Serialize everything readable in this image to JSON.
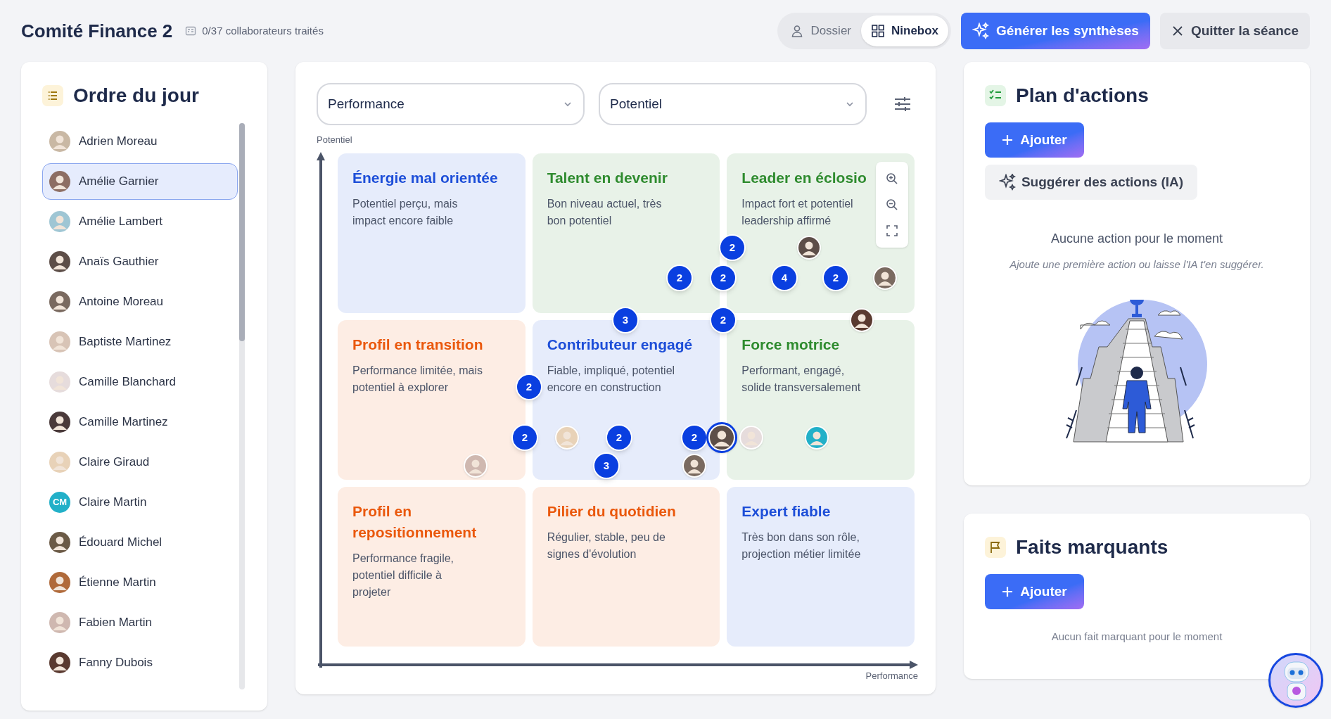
{
  "header": {
    "title": "Comité Finance 2",
    "progress": "0/37 collaborateurs traités"
  },
  "view_toggle": [
    {
      "label": "Dossier",
      "selected": false,
      "kind": "person"
    },
    {
      "label": "Ninebox",
      "selected": true,
      "kind": "grid"
    }
  ],
  "actions": [
    {
      "label": "Générer les synthèses",
      "kind": "primary"
    },
    {
      "label": "Quitter la séance",
      "kind": "secondary"
    }
  ],
  "agenda": {
    "title": "Ordre du jour",
    "items": [
      {
        "name": "Adrien Moreau",
        "selected": false
      },
      {
        "name": "Amélie Garnier",
        "selected": true
      },
      {
        "name": "Amélie Lambert",
        "selected": false
      },
      {
        "name": "Anaïs Gauthier",
        "selected": false
      },
      {
        "name": "Antoine Moreau",
        "selected": false
      },
      {
        "name": "Baptiste Martinez",
        "selected": false
      },
      {
        "name": "Camille Blanchard",
        "selected": false
      },
      {
        "name": "Camille Martinez",
        "selected": false
      },
      {
        "name": "Claire Giraud",
        "selected": false
      },
      {
        "name": "Claire Martin",
        "selected": false,
        "initials": "CM"
      },
      {
        "name": "Édouard Michel",
        "selected": false
      },
      {
        "name": "Étienne Martin",
        "selected": false
      },
      {
        "name": "Fabien Martin",
        "selected": false
      },
      {
        "name": "Fanny Dubois",
        "selected": false
      }
    ]
  },
  "ninebox": {
    "x_select": "Performance",
    "y_select": "Potentiel",
    "y_label": "Potentiel",
    "x_label": "Performance",
    "cells": [
      {
        "title": "Énergie mal orientée",
        "description": "Potentiel perçu, mais impact encore faible",
        "color": "#1d4ed8"
      },
      {
        "title": "Talent en devenir",
        "description": "Bon niveau actuel, très bon potentiel",
        "color": "#2e8b2e"
      },
      {
        "title": "Leader en éclosio",
        "description": "Impact fort et potentiel leadership affirmé",
        "color": "#2e8b2e"
      },
      {
        "title": "Profil en transition",
        "description": "Performance limitée, mais potentiel à explorer",
        "color": "#ea580c"
      },
      {
        "title": "Contributeur engagé",
        "description": "Fiable, impliqué, potentiel encore en construction",
        "color": "#1d4ed8"
      },
      {
        "title": "Force motrice",
        "description": "Performant, engagé, solide transversalement",
        "color": "#2e8b2e"
      },
      {
        "title": "Profil en repositionnement",
        "description": "Performance fragile, potentiel difficile à projeter",
        "color": "#ea580c"
      },
      {
        "title": "Pilier du quotidien",
        "description": "Régulier, stable, peu de signes d'évolution",
        "color": "#ea580c"
      },
      {
        "title": "Expert fiable",
        "description": "Très bon dans son rôle, projection métier limitée",
        "color": "#1d4ed8"
      }
    ],
    "markers": [
      {
        "kind": "count",
        "label": "2"
      },
      {
        "kind": "avatar",
        "selected": false
      },
      {
        "kind": "count",
        "label": "2"
      },
      {
        "kind": "count",
        "label": "2"
      },
      {
        "kind": "count",
        "label": "4"
      },
      {
        "kind": "count",
        "label": "2"
      },
      {
        "kind": "avatar",
        "selected": false
      },
      {
        "kind": "count",
        "label": "3"
      },
      {
        "kind": "count",
        "label": "2"
      },
      {
        "kind": "avatar",
        "selected": false
      },
      {
        "kind": "count",
        "label": "2"
      },
      {
        "kind": "count",
        "label": "2"
      },
      {
        "kind": "avatar",
        "selected": false
      },
      {
        "kind": "count",
        "label": "2"
      },
      {
        "kind": "count",
        "label": "2"
      },
      {
        "kind": "avatar",
        "selected": true
      },
      {
        "kind": "avatar",
        "selected": false
      },
      {
        "kind": "avatar",
        "selected": false
      },
      {
        "kind": "avatar",
        "selected": false
      },
      {
        "kind": "count",
        "label": "3"
      },
      {
        "kind": "avatar",
        "selected": false
      }
    ]
  },
  "plan": {
    "title": "Plan d'actions",
    "add": "Ajouter",
    "suggest": "Suggérer des actions (IA)",
    "empty": "Aucune action pour le moment",
    "hint": "Ajoute une première action ou laisse l'IA t'en suggérer."
  },
  "highlights": {
    "title": "Faits marquants",
    "add": "Ajouter",
    "empty": "Aucun fait marquant pour le moment"
  }
}
